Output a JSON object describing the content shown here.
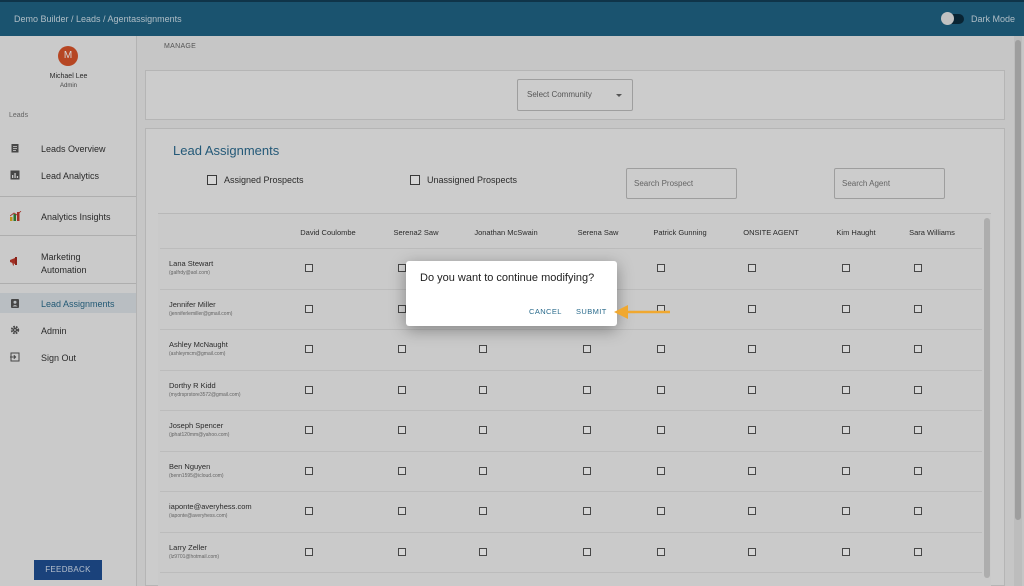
{
  "topbar": {
    "breadcrumb": "Demo Builder  /  Leads / Agentassignments",
    "dark_mode_label": "Dark Mode"
  },
  "user": {
    "initial": "M",
    "name": "Michael Lee",
    "role": "Admin"
  },
  "sidebar": {
    "section_label": "Leads",
    "items": [
      {
        "label": "Leads Overview",
        "icon": "clipboard-icon"
      },
      {
        "label": "Lead Analytics",
        "icon": "chart-box-icon"
      },
      {
        "label": "Analytics Insights",
        "icon": "bar-chart-icon"
      },
      {
        "label": "Marketing\nAutomation",
        "icon": "megaphone-icon"
      },
      {
        "label": "Lead Assignments",
        "icon": "assignment-ind-icon"
      },
      {
        "label": "Admin",
        "icon": "gear-icon"
      },
      {
        "label": "Sign Out",
        "icon": "sign-out-icon"
      }
    ],
    "feedback_label": "FEEDBACK"
  },
  "page": {
    "manage_label": "MANAGE",
    "community_placeholder": "Select Community",
    "title": "Lead Assignments",
    "assigned_label": "Assigned Prospects",
    "unassigned_label": "Unassigned Prospects",
    "search_prospect_placeholder": "Search Prospect",
    "search_agent_placeholder": "Search Agent"
  },
  "table": {
    "columns": [
      "David Coulombe",
      "Serena2 Saw",
      "Jonathan McSwain",
      "Serena Saw",
      "Patrick Gunning",
      "ONSITE AGENT",
      "Kim Haught",
      "Sara Williams"
    ],
    "rows": [
      {
        "name": "Lana Stewart",
        "email": "(galfrdy@aol.com)"
      },
      {
        "name": "Jennifer Miller",
        "email": "(jenniferlemiller@gmail.com)"
      },
      {
        "name": "Ashley McNaught",
        "email": "(ashleymcm@gmail.com)"
      },
      {
        "name": "Dorthy R Kidd",
        "email": "(mydrsprstore3572@gmail.com)"
      },
      {
        "name": "Joseph Spencer",
        "email": "(jphat120mm@yahoo.com)"
      },
      {
        "name": "Ben Nguyen",
        "email": "(benn1595@icloud.com)"
      },
      {
        "name": "iaponte@averyhess.com",
        "email": "(iaponte@averyhess.com)"
      },
      {
        "name": "Larry Zeller",
        "email": "(lz9701@hotmail.com)"
      }
    ]
  },
  "dialog": {
    "question": "Do you want to continue modifying?",
    "cancel_label": "CANCEL",
    "submit_label": "SUBMIT"
  },
  "colors": {
    "topbar": "#1f6385",
    "accent": "#2a6b8c",
    "avatar": "#d9542a",
    "feedback": "#1f4f93",
    "arrow": "#f0a830"
  }
}
